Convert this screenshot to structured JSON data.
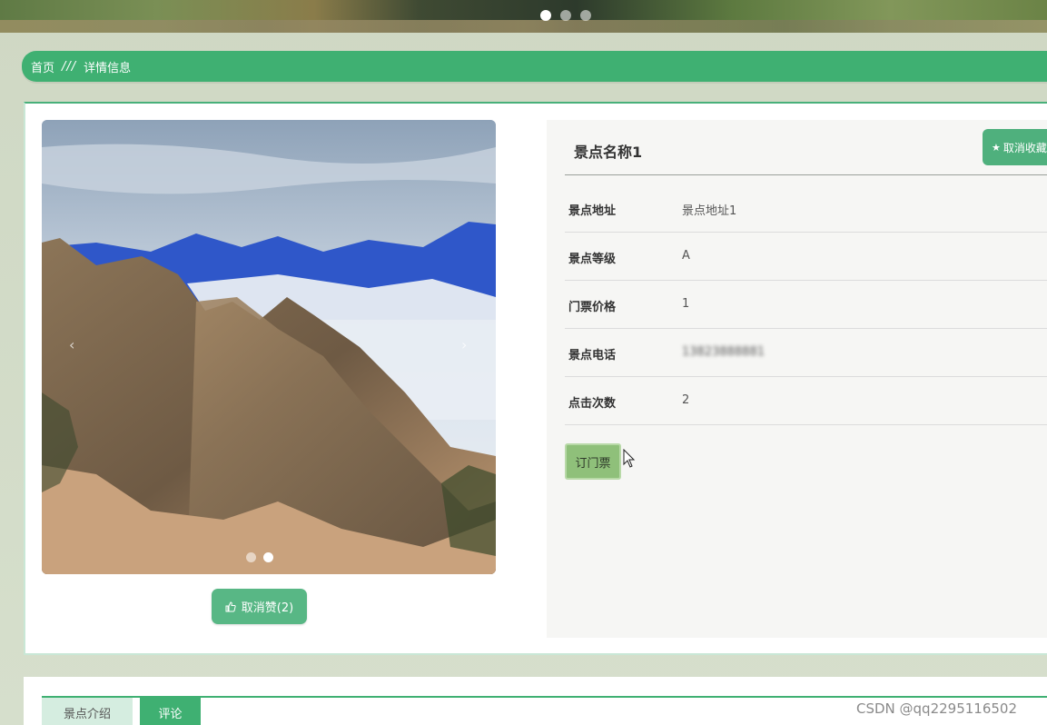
{
  "banner": {
    "carousel_dots": 3,
    "active_dot": 0
  },
  "breadcrumb": {
    "home": "首页",
    "separator": "///",
    "current": "详情信息"
  },
  "gallery": {
    "prev_icon": "chevron-left-icon",
    "next_icon": "chevron-right-icon",
    "dots": 2,
    "active_dot": 1
  },
  "like_button": {
    "icon": "thumbs-up-icon",
    "label": "取消赞(2)"
  },
  "detail": {
    "title": "景点名称1",
    "favorite_button": {
      "icon": "star-icon",
      "label": "取消收藏"
    },
    "fields": [
      {
        "label": "景点地址",
        "value": "景点地址1"
      },
      {
        "label": "景点等级",
        "value": "A"
      },
      {
        "label": "门票价格",
        "value": "1"
      },
      {
        "label": "景点电话",
        "value": "13823888881"
      },
      {
        "label": "点击次数",
        "value": "2"
      }
    ],
    "book_button": "订门票"
  },
  "tabs": [
    {
      "label": "景点介绍",
      "active": false
    },
    {
      "label": "评论",
      "active": true
    }
  ],
  "watermark": "CSDN @qq2295116502",
  "colors": {
    "primary": "#3fb072",
    "like_button": "#58b785",
    "book_button": "#8fc07a",
    "page_bg": "#d3dcc8"
  }
}
